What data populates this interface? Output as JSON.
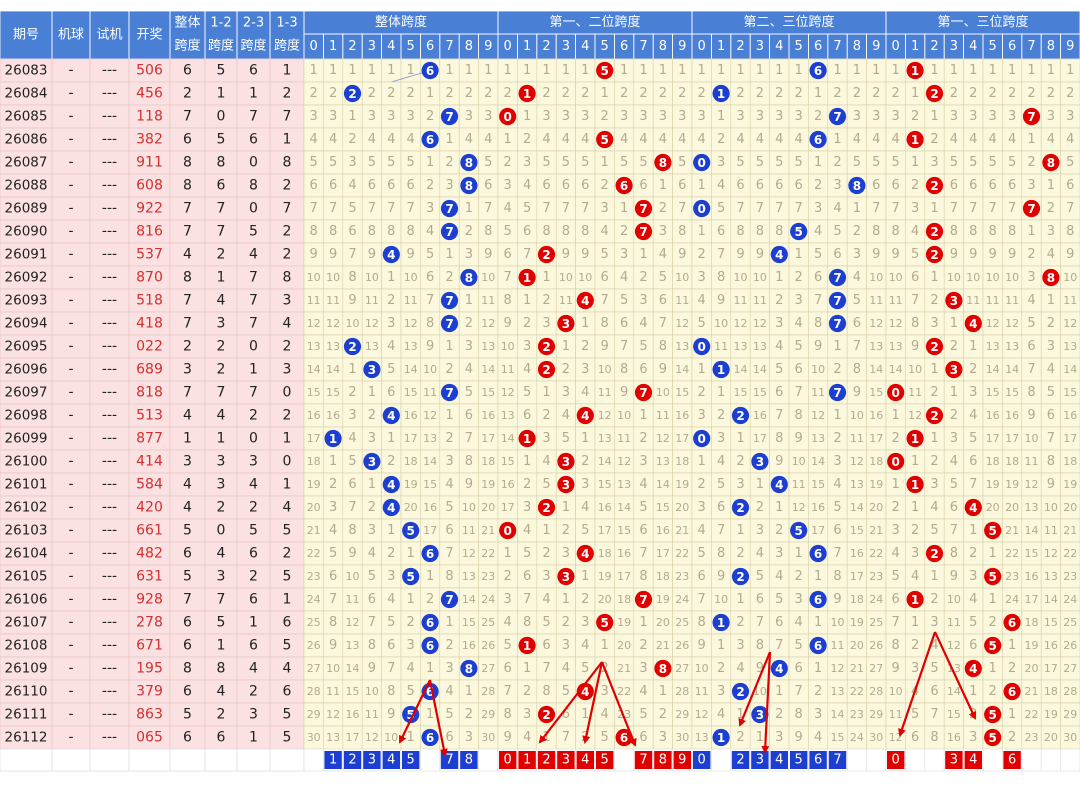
{
  "headers": {
    "left": [
      "期号",
      "机球",
      "试机",
      "开奖"
    ],
    "span": [
      [
        "整体",
        "跨度"
      ],
      [
        "1-2",
        "跨度"
      ],
      [
        "2-3",
        "跨度"
      ],
      [
        "1-3",
        "跨度"
      ]
    ],
    "groups": [
      "整体跨度",
      "第一、二位跨度",
      "第二、三位跨度",
      "第一、三位跨度"
    ],
    "digits": [
      "0",
      "1",
      "2",
      "3",
      "4",
      "5",
      "6",
      "7",
      "8",
      "9"
    ]
  },
  "colors": {
    "header": "#4a7fd6",
    "blue": "#1d3fd1",
    "red": "#e00000",
    "grid_bg": "#fbf8de",
    "left_bg": "#fbe1e1",
    "alt_bg": "#f5e8e8",
    "grid_line": "#d9d0a8",
    "miss_text": "#b4ab8c",
    "arrow": "#e00000"
  },
  "rows": [
    [
      "26083",
      "-",
      "---",
      "506",
      6,
      5,
      6,
      1
    ],
    [
      "26084",
      "-",
      "---",
      "456",
      2,
      1,
      1,
      2
    ],
    [
      "26085",
      "-",
      "---",
      "118",
      7,
      0,
      7,
      7
    ],
    [
      "26086",
      "-",
      "---",
      "382",
      6,
      5,
      6,
      1
    ],
    [
      "26087",
      "-",
      "---",
      "911",
      8,
      8,
      0,
      8
    ],
    [
      "26088",
      "-",
      "---",
      "608",
      8,
      6,
      8,
      2
    ],
    [
      "26089",
      "-",
      "---",
      "922",
      7,
      7,
      0,
      7
    ],
    [
      "26090",
      "-",
      "---",
      "816",
      7,
      7,
      5,
      2
    ],
    [
      "26091",
      "-",
      "---",
      "537",
      4,
      2,
      4,
      2
    ],
    [
      "26092",
      "-",
      "---",
      "870",
      8,
      1,
      7,
      8
    ],
    [
      "26093",
      "-",
      "---",
      "518",
      7,
      4,
      7,
      3
    ],
    [
      "26094",
      "-",
      "---",
      "418",
      7,
      3,
      7,
      4
    ],
    [
      "26095",
      "-",
      "---",
      "022",
      2,
      2,
      0,
      2
    ],
    [
      "26096",
      "-",
      "---",
      "689",
      3,
      2,
      1,
      3
    ],
    [
      "26097",
      "-",
      "---",
      "818",
      7,
      7,
      7,
      0
    ],
    [
      "26098",
      "-",
      "---",
      "513",
      4,
      4,
      2,
      2
    ],
    [
      "26099",
      "-",
      "---",
      "877",
      1,
      1,
      0,
      1
    ],
    [
      "26100",
      "-",
      "---",
      "414",
      3,
      3,
      3,
      0
    ],
    [
      "26101",
      "-",
      "---",
      "584",
      4,
      3,
      4,
      1
    ],
    [
      "26102",
      "-",
      "---",
      "420",
      4,
      2,
      2,
      4
    ],
    [
      "26103",
      "-",
      "---",
      "661",
      5,
      0,
      5,
      5
    ],
    [
      "26104",
      "-",
      "---",
      "482",
      6,
      4,
      6,
      2
    ],
    [
      "26105",
      "-",
      "---",
      "631",
      5,
      3,
      2,
      5
    ],
    [
      "26106",
      "-",
      "---",
      "928",
      7,
      7,
      6,
      1
    ],
    [
      "26107",
      "-",
      "---",
      "278",
      6,
      5,
      1,
      6
    ],
    [
      "26108",
      "-",
      "---",
      "671",
      6,
      1,
      6,
      5
    ],
    [
      "26109",
      "-",
      "---",
      "195",
      8,
      8,
      4,
      4
    ],
    [
      "26110",
      "-",
      "---",
      "379",
      6,
      4,
      2,
      6
    ],
    [
      "26111",
      "-",
      "---",
      "863",
      5,
      2,
      3,
      5
    ],
    [
      "26112",
      "-",
      "---",
      "065",
      6,
      6,
      1,
      5
    ]
  ],
  "bottom": [
    [
      "",
      "1",
      "2",
      "3",
      "4",
      "5",
      "",
      "7",
      "8",
      ""
    ],
    [
      "0",
      "1",
      "2",
      "3",
      "4",
      "5",
      "",
      "7",
      "8",
      "9"
    ],
    [
      "0",
      "",
      "2",
      "3",
      "4",
      "5",
      "6",
      "7",
      "",
      ""
    ],
    [
      "0",
      "",
      "",
      "3",
      "4",
      "",
      "6",
      "",
      "",
      ""
    ]
  ],
  "chart_data": {
    "type": "table",
    "columns": [
      "期号",
      "机球",
      "试机",
      "开奖",
      "整体跨度",
      "1-2跨度",
      "2-3跨度",
      "1-3跨度"
    ],
    "groups": [
      "整体跨度",
      "第一、二位跨度",
      "第二、三位跨度",
      "第一、三位跨度"
    ],
    "draws": [
      "506",
      "456",
      "118",
      "382",
      "911",
      "608",
      "922",
      "816",
      "537",
      "870",
      "518",
      "418",
      "022",
      "689",
      "818",
      "513",
      "877",
      "414",
      "584",
      "420",
      "661",
      "482",
      "631",
      "928",
      "278",
      "671",
      "195",
      "379",
      "863",
      "065"
    ],
    "span_overall": [
      6,
      2,
      7,
      6,
      8,
      8,
      7,
      7,
      4,
      8,
      7,
      7,
      2,
      3,
      7,
      4,
      1,
      3,
      4,
      4,
      5,
      6,
      5,
      7,
      6,
      6,
      8,
      6,
      5,
      6
    ],
    "span_12": [
      5,
      1,
      0,
      5,
      8,
      6,
      7,
      7,
      2,
      1,
      4,
      3,
      2,
      2,
      7,
      4,
      1,
      3,
      3,
      2,
      0,
      4,
      3,
      7,
      5,
      1,
      8,
      4,
      2,
      6
    ],
    "span_23": [
      6,
      1,
      7,
      6,
      0,
      8,
      0,
      5,
      4,
      7,
      7,
      7,
      0,
      1,
      7,
      2,
      0,
      3,
      4,
      2,
      5,
      6,
      2,
      6,
      1,
      6,
      4,
      2,
      3,
      1
    ],
    "span_13": [
      1,
      2,
      7,
      1,
      8,
      2,
      7,
      2,
      2,
      8,
      3,
      4,
      2,
      3,
      0,
      2,
      1,
      0,
      1,
      4,
      5,
      2,
      5,
      1,
      6,
      5,
      4,
      6,
      5,
      5
    ]
  }
}
